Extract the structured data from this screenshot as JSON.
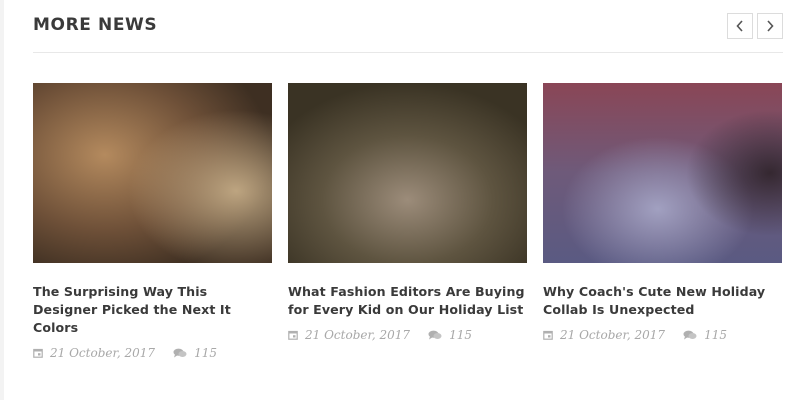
{
  "section": {
    "title": "MORE NEWS",
    "prev_icon": "chevron-left-icon",
    "next_icon": "chevron-right-icon"
  },
  "colors": {
    "text_dark": "#3a3a3a",
    "meta_gray": "#a8a8a8",
    "border": "#e8e8e8"
  },
  "articles": [
    {
      "title": "The Surprising Way This Designer Picked the Next It Colors",
      "date": "21 October, 2017",
      "comments": "115",
      "image_colors": [
        "#8c6a48",
        "#b39670",
        "#4a3829"
      ]
    },
    {
      "title": "What Fashion Editors Are Buying for Every Kid on Our Holiday List",
      "date": "21 October, 2017",
      "comments": "115",
      "image_colors": [
        "#4c4230",
        "#9a8a78",
        "#3a3424"
      ]
    },
    {
      "title": "Why Coach's Cute New Holiday Collab Is Unexpected",
      "date": "21 October, 2017",
      "comments": "115",
      "image_colors": [
        "#8a4a5a",
        "#8a86a8",
        "#3e2e3a"
      ]
    }
  ]
}
